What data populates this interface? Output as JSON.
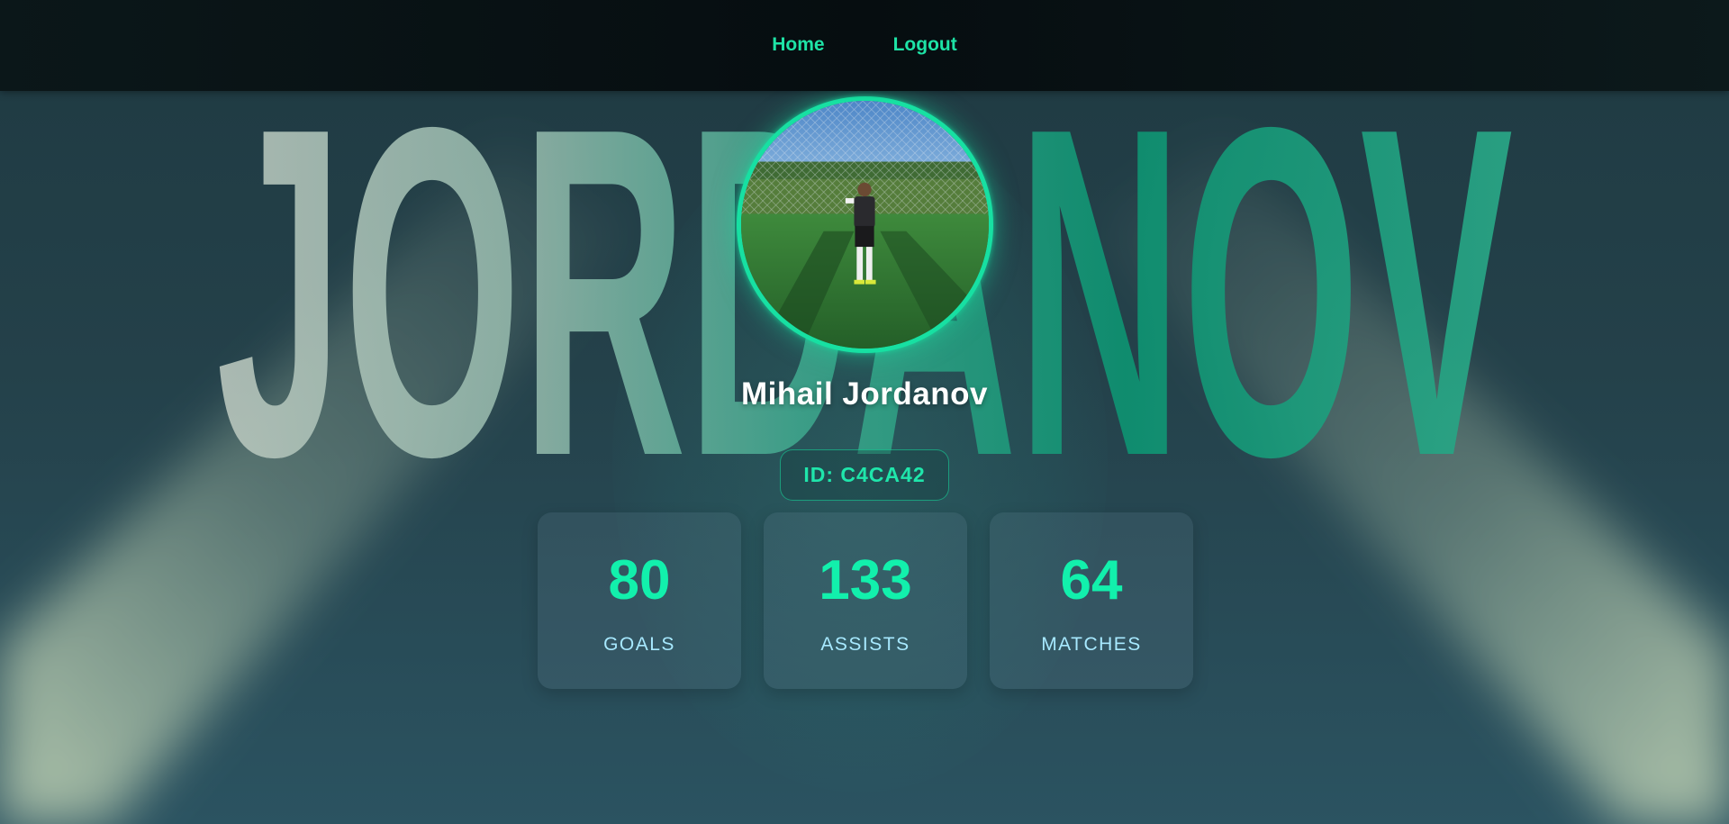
{
  "nav": {
    "links": [
      {
        "label": "Home"
      },
      {
        "label": "Logout"
      }
    ]
  },
  "hero": {
    "background_text": "JORDANOV",
    "colors": {
      "accent": "#17e0a2",
      "stat_value": "#12f0ac",
      "stat_label": "#a7e9ff",
      "name": "#ffffff"
    }
  },
  "profile": {
    "name": "Mihail Jordanov",
    "id_label": "ID: C4CA42",
    "avatar_icon": "player-photo"
  },
  "stats": [
    {
      "value": "80",
      "label": "GOALS"
    },
    {
      "value": "133",
      "label": "ASSISTS"
    },
    {
      "value": "64",
      "label": "MATCHES"
    }
  ]
}
